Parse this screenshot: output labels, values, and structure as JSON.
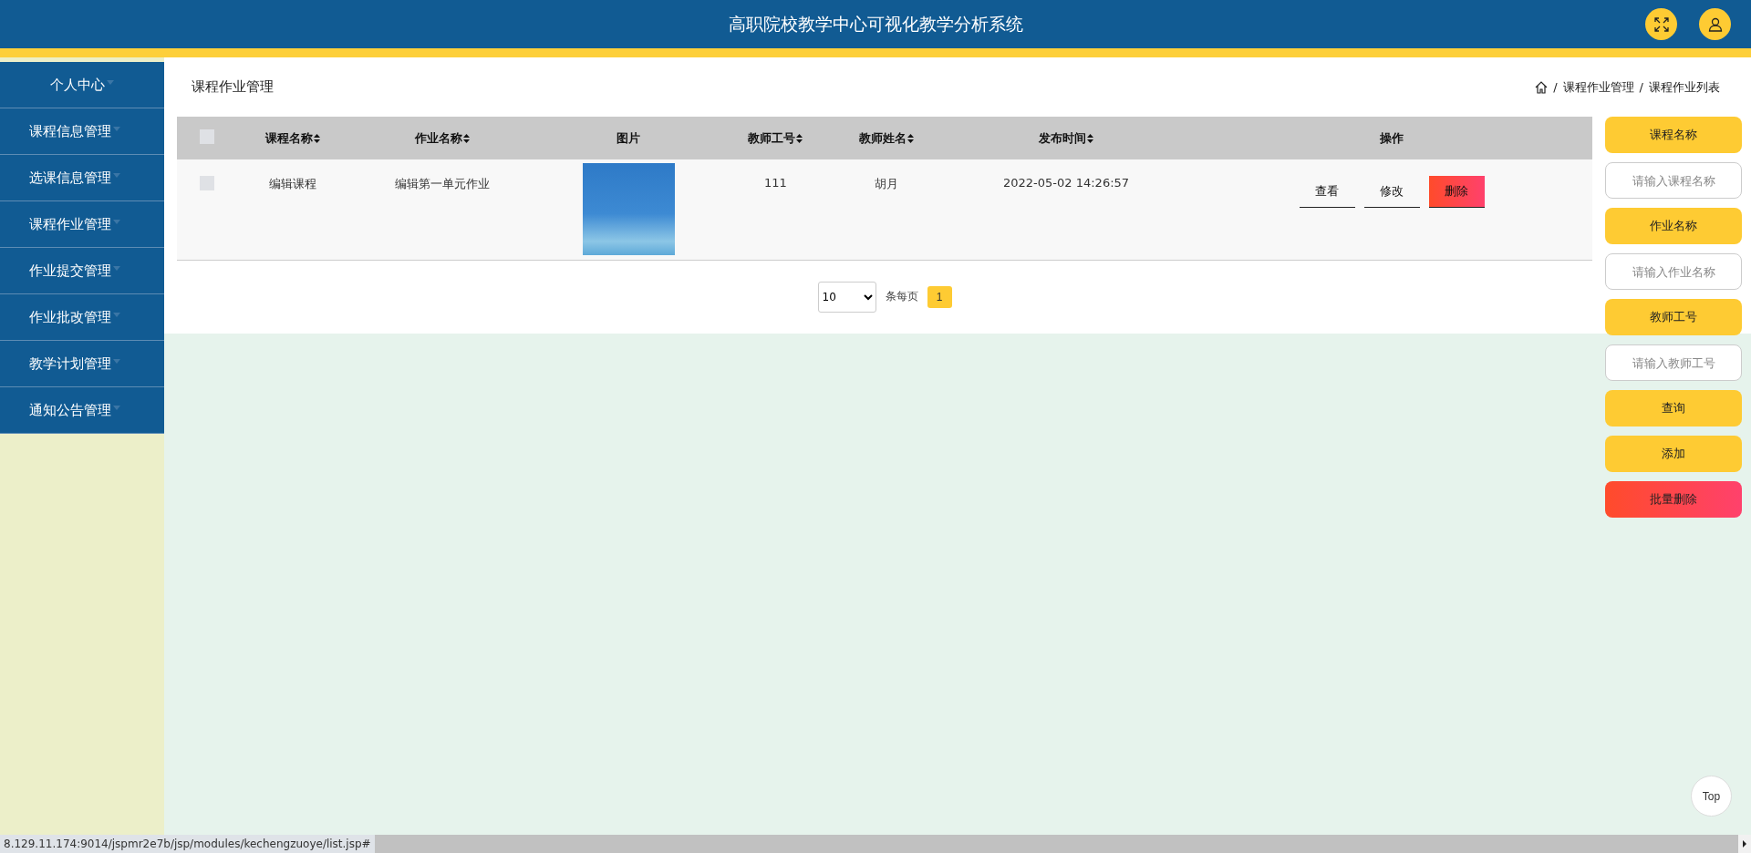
{
  "header": {
    "title": "高职院校教学中心可视化教学分析系统"
  },
  "sidebar": {
    "items": [
      {
        "label": "个人中心",
        "selected": false
      },
      {
        "label": "课程信息管理",
        "selected": false
      },
      {
        "label": "选课信息管理",
        "selected": false
      },
      {
        "label": "课程作业管理",
        "selected": false
      },
      {
        "label": "作业提交管理",
        "selected": false
      },
      {
        "label": "作业批改管理",
        "selected": false
      },
      {
        "label": "教学计划管理",
        "selected": false
      },
      {
        "label": "通知公告管理",
        "selected": false
      }
    ]
  },
  "page_title": "课程作业管理",
  "breadcrumb": {
    "separator": "/",
    "items": [
      "课程作业管理",
      "课程作业列表"
    ]
  },
  "table": {
    "select_all_checked": false,
    "columns": [
      {
        "label": "课程名称",
        "sortable": true
      },
      {
        "label": "作业名称",
        "sortable": true
      },
      {
        "label": "图片",
        "sortable": false
      },
      {
        "label": "教师工号",
        "sortable": true
      },
      {
        "label": "教师姓名",
        "sortable": true
      },
      {
        "label": "发布时间",
        "sortable": true
      },
      {
        "label": "操作",
        "sortable": false
      }
    ],
    "rows": [
      {
        "checked": false,
        "cells": [
          "编辑课程",
          "编辑第一单元作业",
          "",
          "111",
          "胡月",
          "2022-05-02 14:26:57"
        ],
        "actions": [
          {
            "label": "查看",
            "kind": "plain"
          },
          {
            "label": "修改",
            "kind": "plain"
          },
          {
            "label": "删除",
            "kind": "danger"
          }
        ]
      }
    ]
  },
  "pagination": {
    "page_size": "10",
    "per_page_label": "条每页",
    "pages": [
      {
        "label": "1",
        "selected": true
      }
    ]
  },
  "search": [
    {
      "kind": "label",
      "text": "课程名称"
    },
    {
      "kind": "input",
      "placeholder": "请输入课程名称"
    },
    {
      "kind": "label",
      "text": "作业名称"
    },
    {
      "kind": "input",
      "placeholder": "请输入作业名称"
    },
    {
      "kind": "label",
      "text": "教师工号"
    },
    {
      "kind": "input",
      "placeholder": "请输入教师工号"
    },
    {
      "kind": "button",
      "text": "查询"
    },
    {
      "kind": "button",
      "text": "添加"
    },
    {
      "kind": "danger",
      "text": "批量删除"
    }
  ],
  "top_button": "Top",
  "status_url": "8.129.11.174:9014/jspmr2e7b/jsp/modules/kechengzuoye/list.jsp#"
}
